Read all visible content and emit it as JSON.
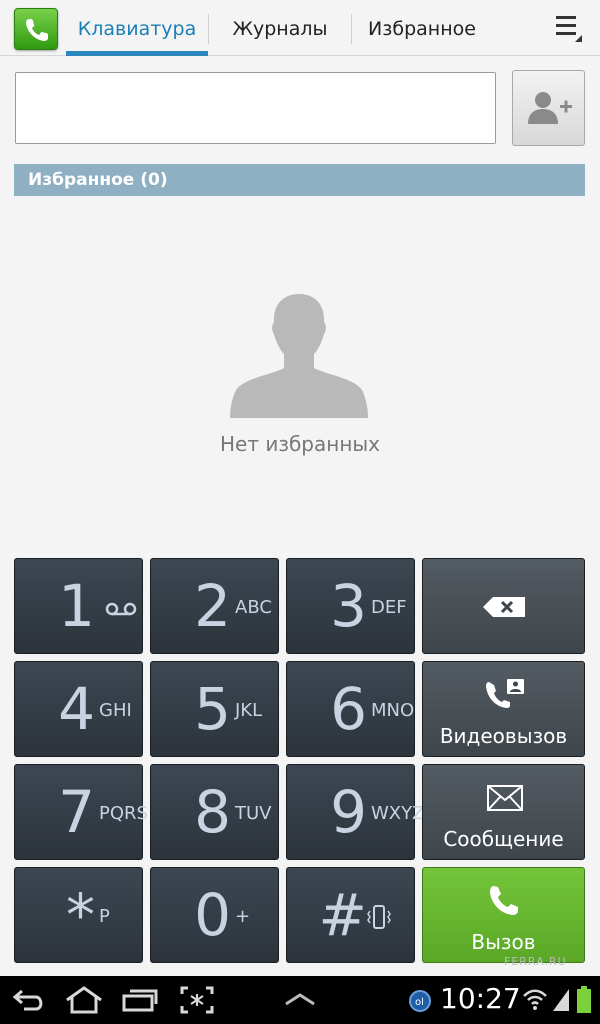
{
  "tabs": [
    {
      "label": "Клавиатура",
      "active": true
    },
    {
      "label": "Журналы",
      "active": false
    },
    {
      "label": "Избранное",
      "active": false
    }
  ],
  "dialer": {
    "number_value": "",
    "favorites_header": "Избранное (0)",
    "empty_text": "Нет избранных"
  },
  "keys": [
    {
      "digit": "1",
      "letters": ""
    },
    {
      "digit": "2",
      "letters": "ABC"
    },
    {
      "digit": "3",
      "letters": "DEF"
    },
    {
      "digit": "4",
      "letters": "GHI"
    },
    {
      "digit": "5",
      "letters": "JKL"
    },
    {
      "digit": "6",
      "letters": "MNO"
    },
    {
      "digit": "7",
      "letters": "PQRS"
    },
    {
      "digit": "8",
      "letters": "TUV"
    },
    {
      "digit": "9",
      "letters": "WXYZ"
    },
    {
      "digit": "*",
      "letters": "P"
    },
    {
      "digit": "0",
      "letters": "+"
    },
    {
      "digit": "#",
      "letters": ""
    }
  ],
  "actions": {
    "video_call_label": "Видеовызов",
    "message_label": "Сообщение",
    "call_label": "Вызов"
  },
  "status": {
    "time": "10:27"
  },
  "watermark": "FERRA.RU",
  "colors": {
    "accent": "#2a86bd",
    "header_bar": "#8fb0c3",
    "key_bg": "#333b44",
    "call_green": "#5aa826"
  }
}
